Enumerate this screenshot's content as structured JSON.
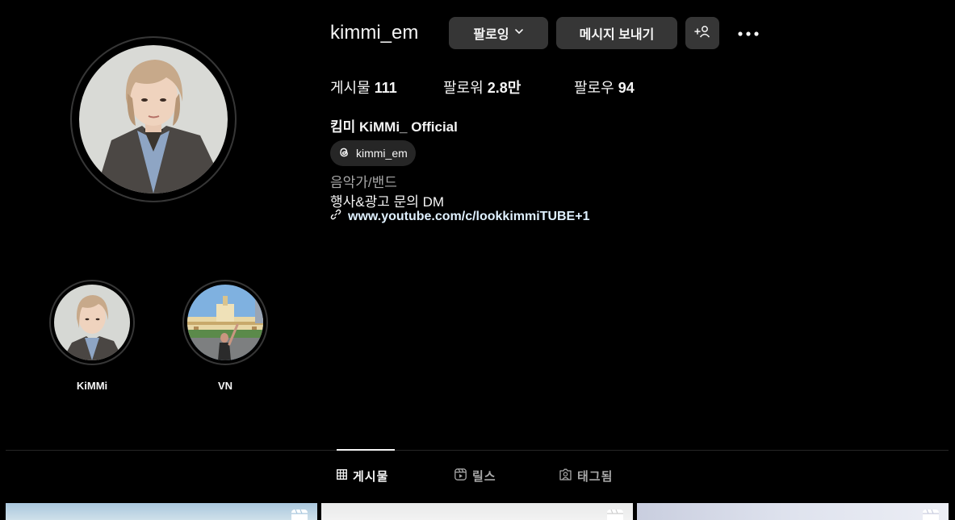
{
  "profile": {
    "username": "kimmi_em",
    "full_name": "킴미 KiMMi_ Official",
    "threads_handle": "kimmi_em",
    "category": "음악가/밴드",
    "bio": "행사&광고 문의 DM",
    "link": "www.youtube.com/c/lookkimmiTUBE+1"
  },
  "actions": {
    "following_label": "팔로잉",
    "message_label": "메시지 보내기"
  },
  "stats": {
    "posts_label": "게시물",
    "posts_value": "111",
    "followers_label": "팔로워",
    "followers_value": "2.8만",
    "following_label": "팔로우",
    "following_value": "94"
  },
  "highlights": [
    {
      "label": "KiMMi"
    },
    {
      "label": "VN"
    }
  ],
  "tabs": [
    {
      "label": "게시물",
      "icon": "grid-icon",
      "active": true
    },
    {
      "label": "릴스",
      "icon": "reels-icon",
      "active": false
    },
    {
      "label": "태그됨",
      "icon": "tagged-icon",
      "active": false
    }
  ],
  "colors": {
    "background": "#000000",
    "button": "#363636",
    "secondary_text": "#a8a8a8",
    "link": "#e0f1ff"
  }
}
